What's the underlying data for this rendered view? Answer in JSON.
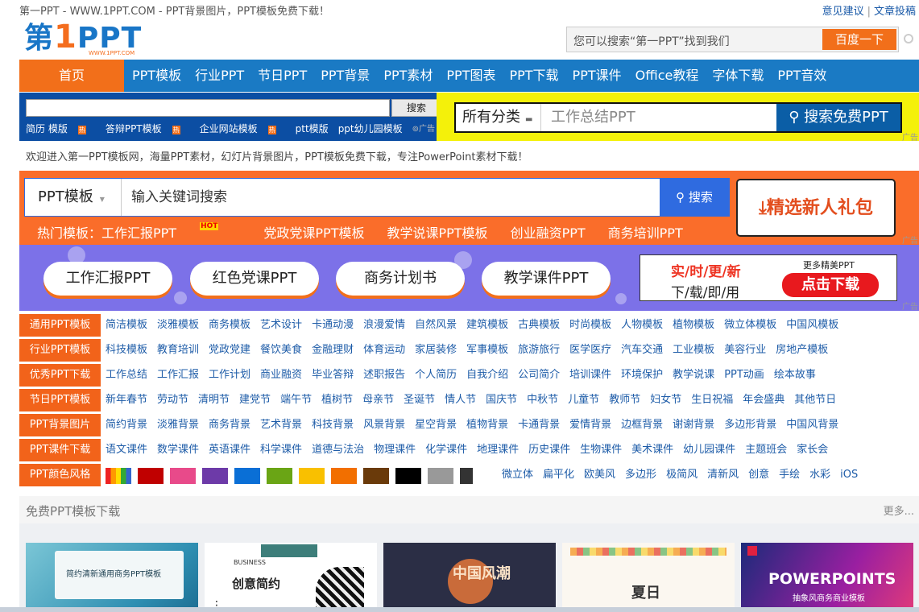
{
  "topbar": {
    "site_text": "第一PPT - WWW.1PPT.COM - PPT背景图片，PPT模板免费下载！",
    "feedback": "意见建议",
    "separator": "|",
    "submit": "文章投稿"
  },
  "logo": {
    "prefix": "第",
    "one": "1",
    "suffix": "PPT",
    "url": "WWW.1PPT.COM"
  },
  "top_search": {
    "placeholder": "您可以搜索“第一PPT”找到我们",
    "button": "百度一下"
  },
  "nav": {
    "home": "首页",
    "items": [
      "PPT模板",
      "行业PPT",
      "节日PPT",
      "PPT背景",
      "PPT素材",
      "PPT图表",
      "PPT下载",
      "PPT课件",
      "Office教程",
      "字体下载",
      "PPT音效"
    ]
  },
  "ad_left": {
    "search_button": "搜索",
    "hot": [
      "简历 模版",
      "答辩PPT模板",
      "企业网站模板",
      "ptt模版",
      "ppt幼儿园模板"
    ],
    "hot_badge": "热",
    "ad_tag": "广告"
  },
  "ad_right": {
    "category": "所有分类",
    "placeholder": "工作总结PPT",
    "button": "搜索免费PPT"
  },
  "ad_label": "广告",
  "welcome": "欢迎进入第一PPT模板网，海量PPT素材，幻灯片背景图片，PPT模板免费下载，专注PowerPoint素材下载！",
  "banner": {
    "select": "PPT模板",
    "placeholder": "输入关键词搜索",
    "search_button": "搜索",
    "gift": "精选新人礼包",
    "hot_label": "热门模板：工作汇报PPT",
    "hot_badge": "HOT",
    "hot_items": [
      "党政党课PPT模板",
      "教学说课PPT模板",
      "创业融资PPT",
      "商务培训PPT"
    ]
  },
  "promo": {
    "pills": [
      "工作汇报PPT",
      "红色党课PPT",
      "商务计划书",
      "教学课件PPT"
    ],
    "realtime": "实/时/更/新",
    "instant": "下/载/即/用",
    "more": "更多精美PPT",
    "download": "点击下载"
  },
  "categories": [
    {
      "label": "通用PPT模板",
      "items": [
        "简洁模板",
        "淡雅模板",
        "商务模板",
        "艺术设计",
        "卡通动漫",
        "浪漫爱情",
        "自然风景",
        "建筑模板",
        "古典模板",
        "时尚模板",
        "人物模板",
        "植物模板",
        "微立体模板",
        "中国风模板"
      ]
    },
    {
      "label": "行业PPT模板",
      "items": [
        "科技模板",
        "教育培训",
        "党政党建",
        "餐饮美食",
        "金融理财",
        "体育运动",
        "家居装修",
        "军事模板",
        "旅游旅行",
        "医学医疗",
        "汽车交通",
        "工业模板",
        "美容行业",
        "房地产模板"
      ]
    },
    {
      "label": "优秀PPT下载",
      "items": [
        "工作总结",
        "工作汇报",
        "工作计划",
        "商业融资",
        "毕业答辩",
        "述职报告",
        "个人简历",
        "自我介绍",
        "公司简介",
        "培训课件",
        "环境保护",
        "教学说课",
        "PPT动画",
        "绘本故事"
      ]
    },
    {
      "label": "节日PPT模板",
      "items": [
        "新年春节",
        "劳动节",
        "清明节",
        "建党节",
        "端午节",
        "植树节",
        "母亲节",
        "圣诞节",
        "情人节",
        "国庆节",
        "中秋节",
        "儿童节",
        "教师节",
        "妇女节",
        "生日祝福",
        "年会盛典",
        "其他节日"
      ]
    },
    {
      "label": "PPT背景图片",
      "items": [
        "简约背景",
        "淡雅背景",
        "商务背景",
        "艺术背景",
        "科技背景",
        "风景背景",
        "星空背景",
        "植物背景",
        "卡通背景",
        "爱情背景",
        "边框背景",
        "谢谢背景",
        "多边形背景",
        "中国风背景"
      ]
    },
    {
      "label": "PPT课件下载",
      "items": [
        "语文课件",
        "数学课件",
        "英语课件",
        "科学课件",
        "道德与法治",
        "物理课件",
        "化学课件",
        "地理课件",
        "历史课件",
        "生物课件",
        "美术课件",
        "幼儿园课件",
        "主题班会",
        "家长会"
      ]
    }
  ],
  "color_row": {
    "label": "PPT颜色风格",
    "swatches": [
      "#c00000",
      "#e84a8a",
      "#6d3aa8",
      "#0a6fd6",
      "#6aa515",
      "#f9c000",
      "#f26f00",
      "#6a3a0a",
      "#000000",
      "#999999"
    ],
    "styles": [
      "微立体",
      "扁平化",
      "欧美风",
      "多边形",
      "极简风",
      "清新风",
      "创意",
      "手绘",
      "水彩",
      "iOS"
    ]
  },
  "free": {
    "title": "免费PPT模板下载",
    "more": "更多..."
  },
  "thumbs": [
    {
      "caption": "简约清新通用商务PPT模板"
    },
    {
      "caption": "创意简约",
      "tag": "BUSINESS"
    },
    {
      "caption": "中国风潮"
    },
    {
      "caption": "夏日"
    },
    {
      "caption": "POWERPOINTS",
      "sub": "抽象风商务商业模板"
    }
  ]
}
